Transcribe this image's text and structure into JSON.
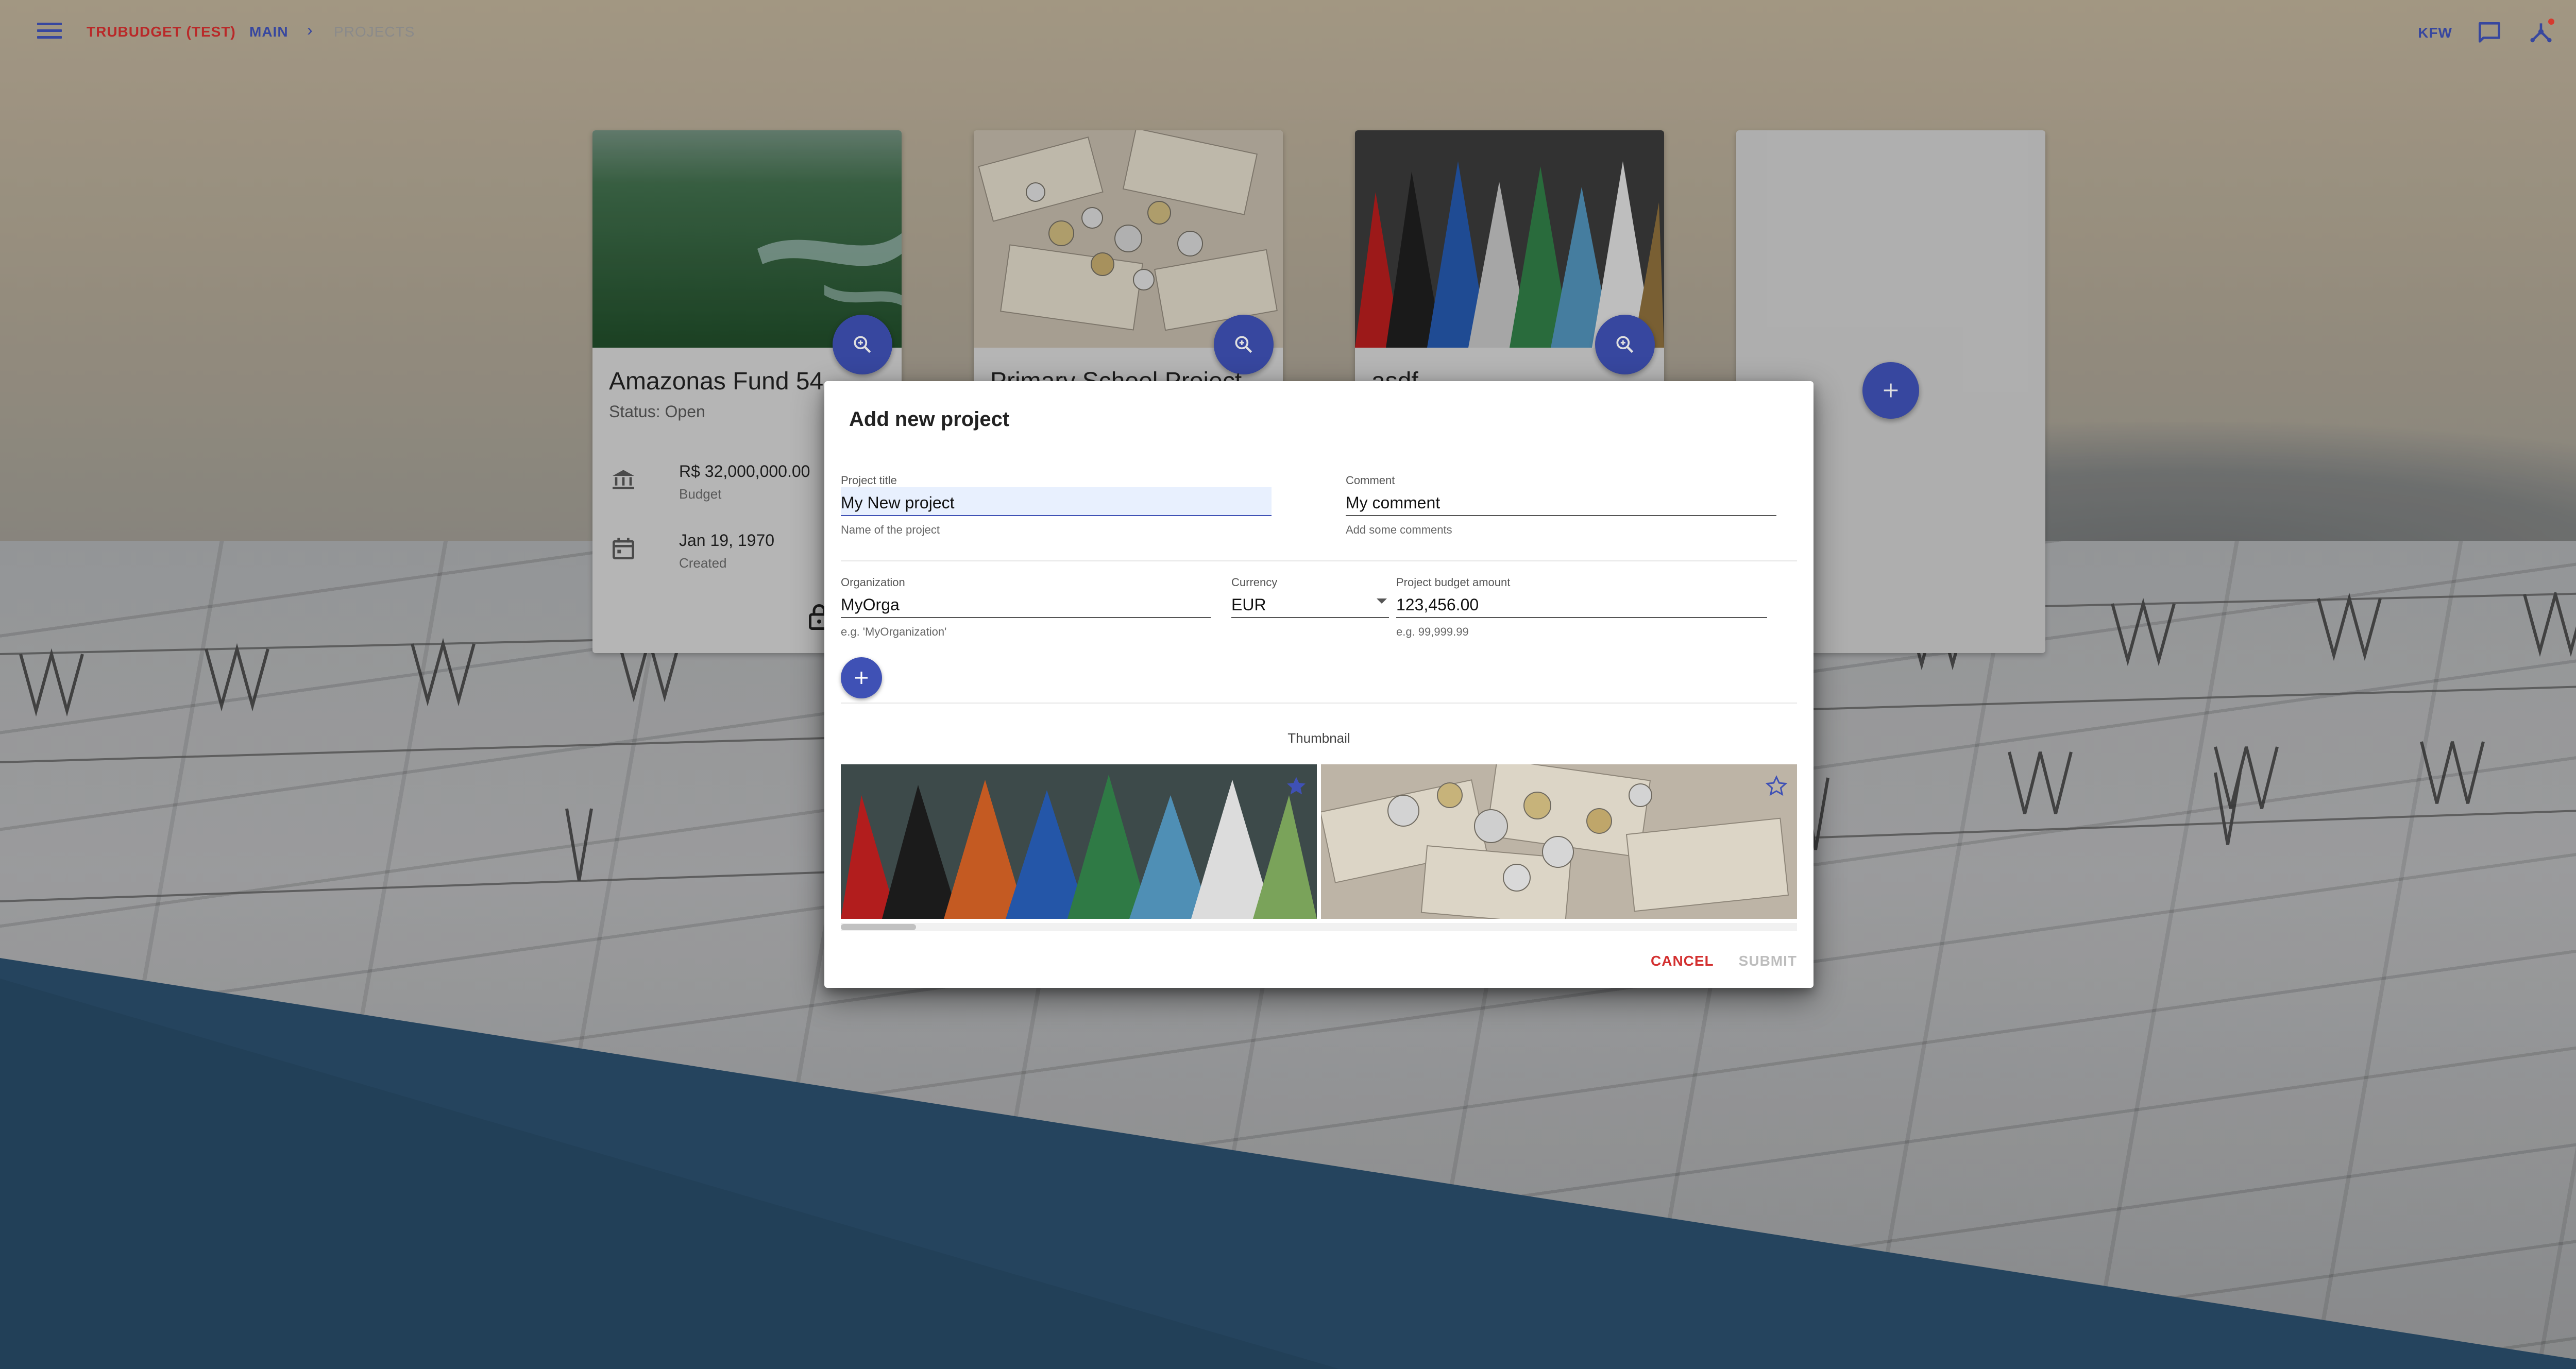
{
  "header": {
    "brand": "TRUBUDGET (TEST)",
    "main": "MAIN",
    "separator": "›",
    "current": "PROJECTS",
    "organization": "KFW",
    "icons": [
      "menu-icon",
      "chat-icon",
      "network-icon",
      "power-icon"
    ]
  },
  "projects": [
    {
      "title": "Amazonas Fund 54",
      "status": "Status: Open",
      "budget_value": "R$ 32,000,000.00",
      "budget_label": "Budget",
      "created_value": "Jan 19, 1970",
      "created_label": "Created"
    },
    {
      "title": "Primary School Project"
    },
    {
      "title": "asdf"
    }
  ],
  "dialog": {
    "title": "Add new project",
    "project_title": {
      "label": "Project title",
      "value": "My New project",
      "help": "Name of the project"
    },
    "comment": {
      "label": "Comment",
      "value": "My comment",
      "help": "Add some comments"
    },
    "organization": {
      "label": "Organization",
      "value": "MyOrga",
      "help": "e.g. 'MyOrganization'"
    },
    "currency": {
      "label": "Currency",
      "value": "EUR"
    },
    "budget_amount": {
      "label": "Project budget amount",
      "value": "123,456.00",
      "help": "e.g. 99,999.99"
    },
    "thumbnail_label": "Thumbnail",
    "thumbnails": [
      {
        "name": "pencils",
        "selected": true
      },
      {
        "name": "money",
        "selected": false
      }
    ],
    "cancel": "CANCEL",
    "submit": "SUBMIT"
  },
  "colors": {
    "primary": "#3f51b5",
    "accent": "#d32f2f",
    "background_blue": "#2c4f6b"
  }
}
